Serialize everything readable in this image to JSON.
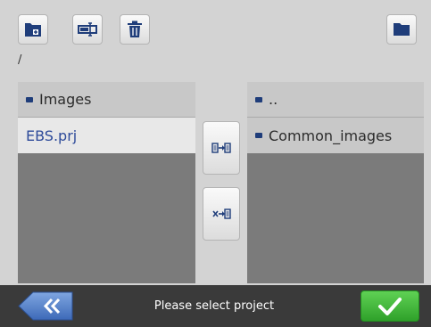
{
  "toolbar": {
    "new_folder": {
      "icon": "new-folder-icon"
    },
    "rename": {
      "icon": "rename-icon"
    },
    "delete": {
      "icon": "trash-icon"
    },
    "open_folder": {
      "icon": "folder-icon"
    }
  },
  "current_path": "/",
  "left_list": {
    "header": "Images",
    "items": [
      {
        "label": "EBS.prj",
        "selected": true
      }
    ]
  },
  "right_list": {
    "header": "..",
    "items": [
      {
        "label": "Common_images"
      }
    ]
  },
  "actions": {
    "copy": {
      "icon": "copy-to-list-icon"
    },
    "move_remove": {
      "icon": "remove-to-list-icon"
    }
  },
  "bottom_bar": {
    "status": "Please select project",
    "back_icon": "double-chevron-left-icon",
    "confirm_icon": "checkmark-icon"
  },
  "colors": {
    "accent_blue": "#1f3d7a",
    "confirm_green": "#3fb537",
    "list_bg": "#7b7b7b",
    "selected_row": "#e8e8e8"
  }
}
